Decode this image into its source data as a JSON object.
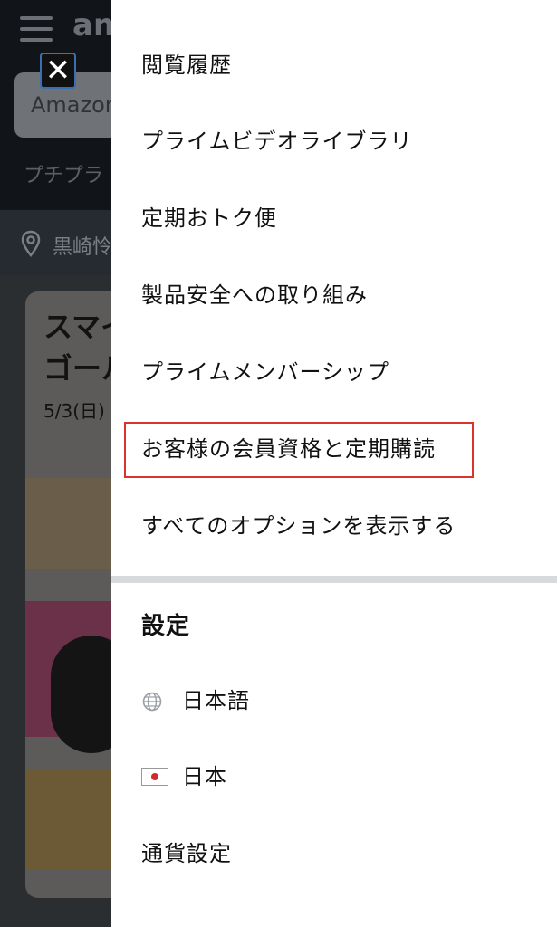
{
  "background": {
    "logo": "am",
    "search_placeholder": "Amazon",
    "subnav_text": "プチプラ",
    "location_text": "黒崎怜",
    "promo_text_line1": "スマイ",
    "promo_text_line2": "ゴール",
    "promo_date": "5/3(日)"
  },
  "close_button": {
    "icon": "close-icon",
    "label": "✕"
  },
  "menu": {
    "items": [
      {
        "label": "閲覧履歴"
      },
      {
        "label": "プライムビデオライブラリ"
      },
      {
        "label": "定期おトク便"
      },
      {
        "label": "製品安全への取り組み"
      },
      {
        "label": "プライムメンバーシップ"
      },
      {
        "label": "お客様の会員資格と定期購読",
        "highlighted": true
      },
      {
        "label": "すべてのオプションを表示する"
      }
    ]
  },
  "settings": {
    "title": "設定",
    "language": {
      "icon": "globe-icon",
      "label": "日本語"
    },
    "country": {
      "icon": "japan-flag-icon",
      "label": "日本"
    },
    "currency": {
      "label": "通貨設定"
    }
  },
  "colors": {
    "highlight_border": "#d9342b",
    "drawer_bg": "#ffffff",
    "divider": "#d7dadd"
  }
}
